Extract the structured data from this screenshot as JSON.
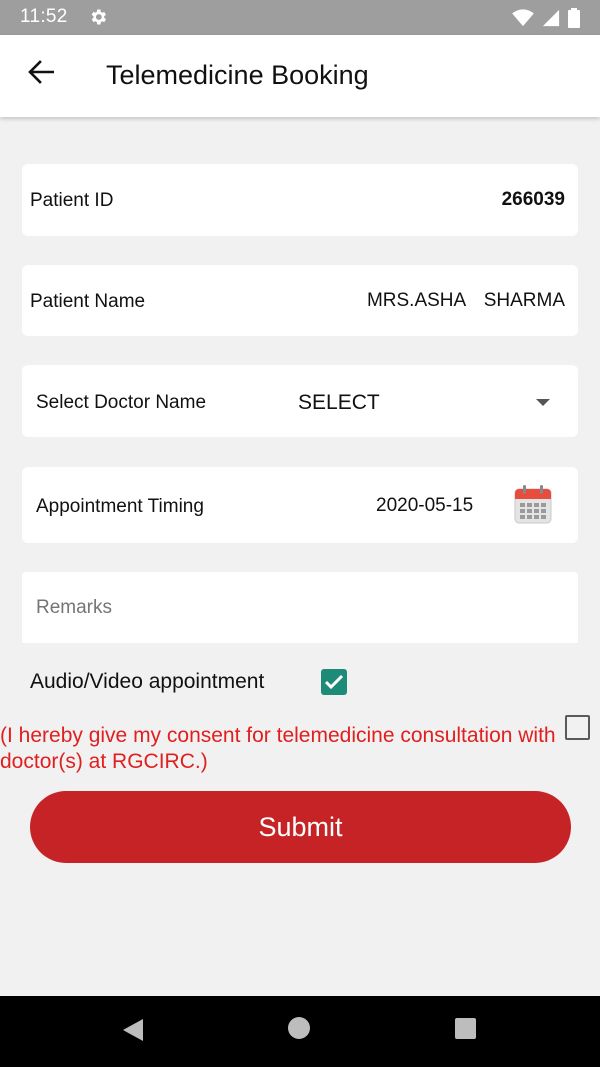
{
  "status_bar": {
    "time": "11:52",
    "icons": [
      "settings-gear-icon",
      "wifi-icon",
      "signal-icon",
      "battery-icon"
    ]
  },
  "app_bar": {
    "title": "Telemedicine Booking",
    "back_icon": "arrow-back-icon"
  },
  "form": {
    "patient_id": {
      "label": "Patient ID",
      "value": "266039"
    },
    "patient_name": {
      "label": "Patient Name",
      "value": "MRS.ASHA  SHARMA"
    },
    "doctor": {
      "label": "Select Doctor Name",
      "selected": "SELECT"
    },
    "timing": {
      "label": "Appointment Timing",
      "value": "2020-05-15",
      "icon": "calendar-icon"
    },
    "remarks": {
      "placeholder": "Remarks"
    },
    "audio_video": {
      "label": "Audio/Video appointment",
      "checked": true
    },
    "consent": {
      "text": "(I hereby give my consent for telemedicine consultation with doctor(s) at RGCIRC.)",
      "checked": false
    },
    "submit_label": "Submit"
  },
  "colors": {
    "accent_red": "#c62326",
    "consent_red": "#e02020",
    "check_teal": "#1e8a78",
    "background": "#f1f1f1"
  },
  "nav_bar": {
    "icons": [
      "nav-back-icon",
      "nav-home-icon",
      "nav-recents-icon"
    ]
  }
}
